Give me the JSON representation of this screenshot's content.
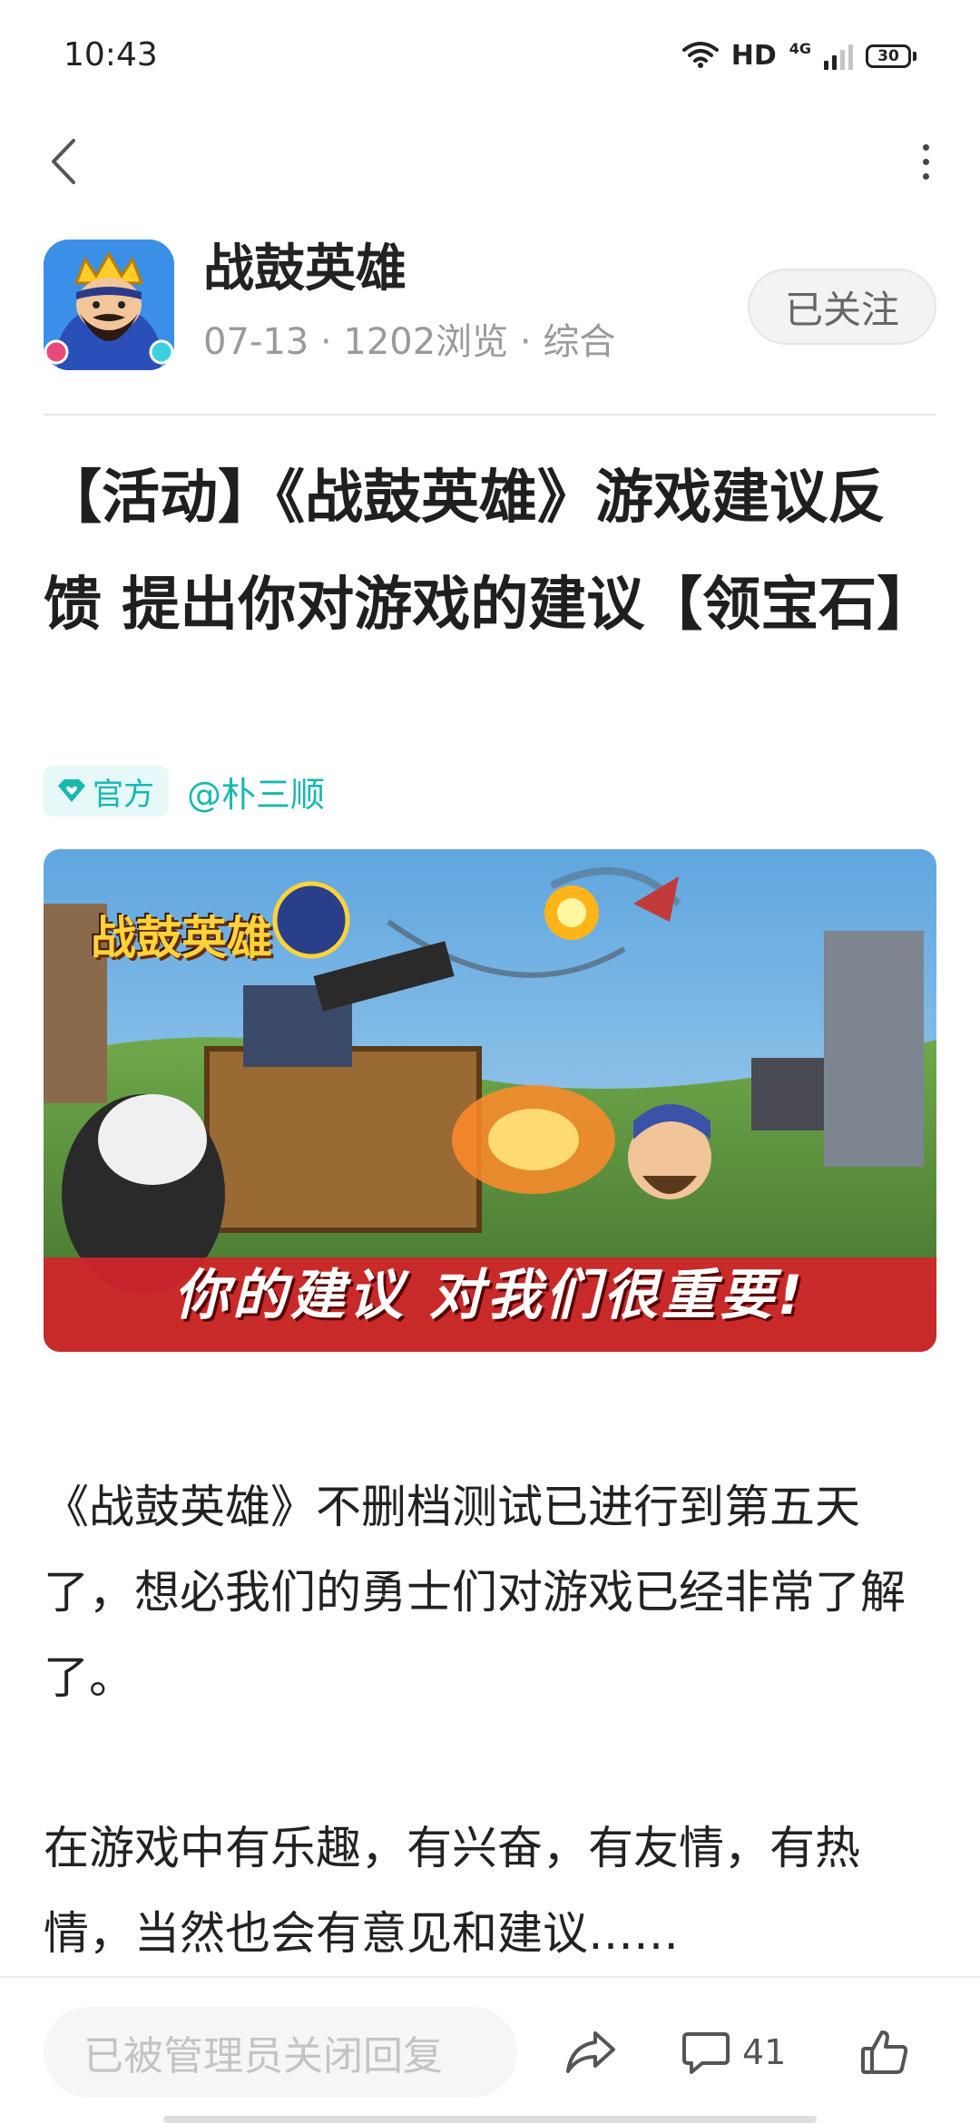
{
  "status_bar": {
    "time": "10:43",
    "network_label": "HD",
    "network_type": "4G",
    "battery": "30"
  },
  "author": {
    "name": "战鼓英雄",
    "meta": "07-13 · 1202浏览 · 综合",
    "follow_label": "已关注"
  },
  "post": {
    "title": "【活动】《战鼓英雄》游戏建议反馈 提出你对游戏的建议【领宝石】",
    "official_label": "官方",
    "mention": "@朴三顺",
    "banner_logo_text": "战鼓英雄",
    "banner_slogan": "你的建议 对我们很重要!",
    "paragraphs": [
      "《战鼓英雄》不删档测试已进行到第五天了，想必我们的勇士们对游戏已经非常了解了。",
      "在游戏中有乐趣，有兴奋，有友情，有热情，当然也会有意见和建议……"
    ]
  },
  "bottom_bar": {
    "reply_placeholder": "已被管理员关闭回复",
    "comment_count": "41"
  },
  "colors": {
    "accent": "#17b8b0",
    "text_primary": "#222222",
    "text_secondary": "#9a9a9a"
  },
  "icons": {
    "back": "chevron-left-icon",
    "more": "more-vertical-icon",
    "official": "diamond-heart-icon",
    "share": "share-arrow-icon",
    "comment": "comment-bubble-icon",
    "like": "thumbs-up-icon"
  }
}
